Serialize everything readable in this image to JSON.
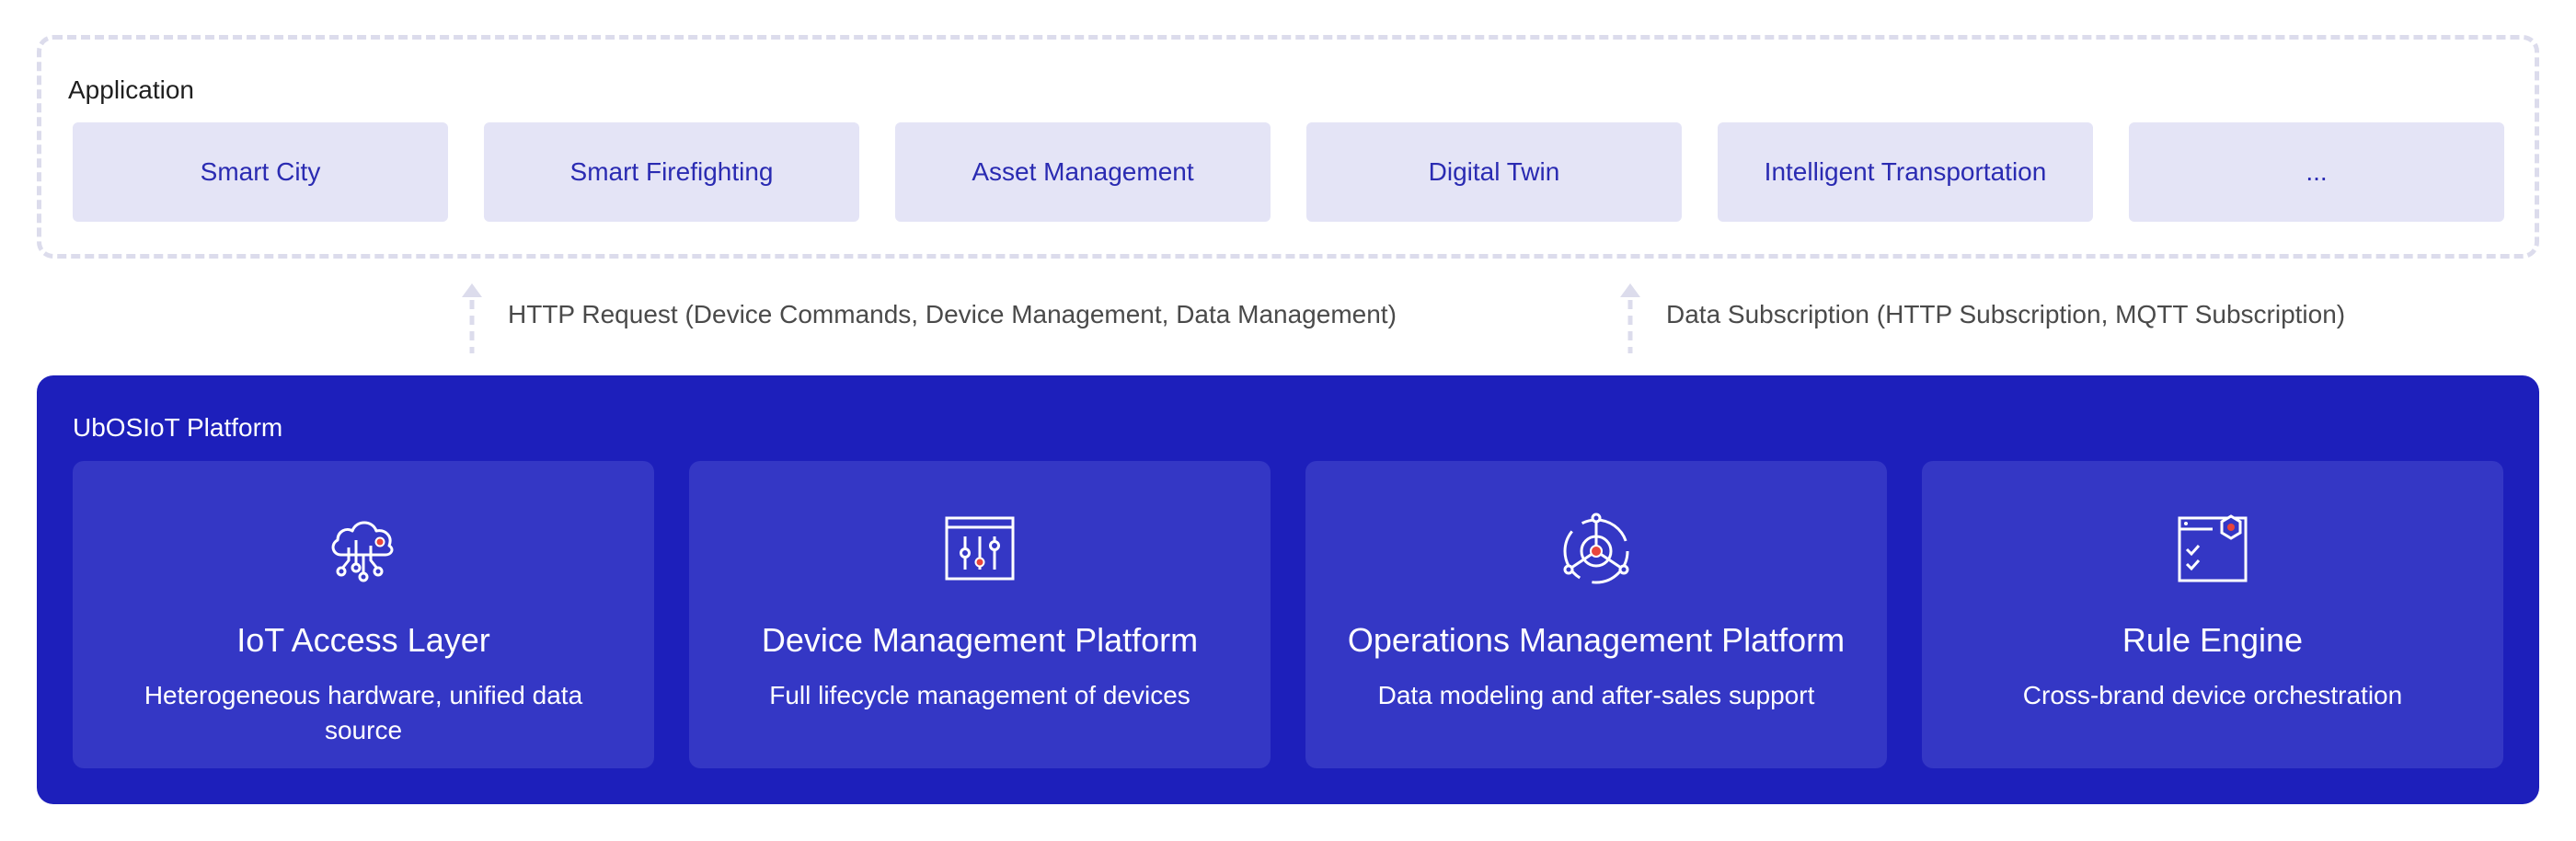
{
  "application": {
    "title": "Application",
    "cards": [
      {
        "label": "Smart City"
      },
      {
        "label": "Smart Firefighting"
      },
      {
        "label": "Asset Management"
      },
      {
        "label": "Digital Twin"
      },
      {
        "label": "Intelligent Transportation"
      },
      {
        "label": "..."
      }
    ]
  },
  "connections": [
    {
      "label": "HTTP Request (Device Commands, Device Management, Data Management)"
    },
    {
      "label": "Data Subscription (HTTP Subscription, MQTT Subscription)"
    }
  ],
  "platform": {
    "title": "UbOSIoT Platform",
    "modules": [
      {
        "icon": "cloud-network-icon",
        "title": "IoT Access Layer",
        "description": "Heterogeneous hardware, unified data source"
      },
      {
        "icon": "control-sliders-icon",
        "title": "Device Management Platform",
        "description": "Full lifecycle management of devices"
      },
      {
        "icon": "operations-hub-icon",
        "title": "Operations Management Platform",
        "description": "Data modeling and after-sales support"
      },
      {
        "icon": "rule-window-icon",
        "title": "Rule Engine",
        "description": "Cross-brand device orchestration"
      }
    ]
  },
  "colors": {
    "platform_bg": "#1d1fbb",
    "module_bg": "#3437c5",
    "card_bg": "#e4e4f6",
    "card_text": "#2a2bb2",
    "accent": "#e8453c"
  }
}
